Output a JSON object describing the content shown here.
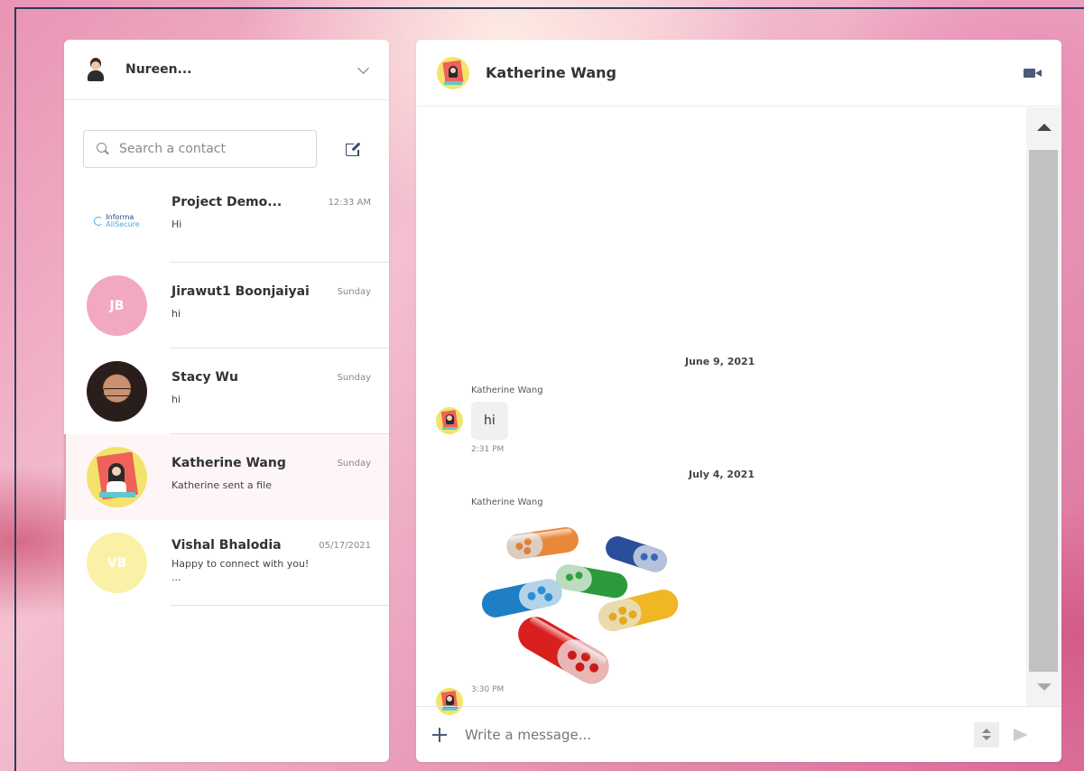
{
  "account": {
    "name": "Nureen..."
  },
  "search": {
    "placeholder": "Search a contact"
  },
  "contacts": [
    {
      "name": "Project Demo...",
      "preview": "Hi",
      "time": "12:33 AM",
      "avatar": "logo",
      "logo_line1": "Informa",
      "logo_line2": "AllSecure"
    },
    {
      "name": "Jirawut1 Boonjaiyai",
      "preview": "hi",
      "time": "Sunday",
      "avatar": "initials",
      "initials": "JB",
      "color": "#f2a8c0"
    },
    {
      "name": "Stacy Wu",
      "preview": "hi",
      "time": "Sunday",
      "avatar": "photo"
    },
    {
      "name": "Katherine Wang",
      "preview": "Katherine sent a file",
      "time": "Sunday",
      "avatar": "photo",
      "active": true
    },
    {
      "name": "Vishal Bhalodia",
      "preview": "Happy to connect with you!",
      "preview2": "...",
      "time": "05/17/2021",
      "avatar": "initials",
      "initials": "VB",
      "color": "#fbf1a6"
    }
  ],
  "chat": {
    "title": "Katherine Wang",
    "groups": [
      {
        "date": "June 9, 2021",
        "sender": "Katherine Wang",
        "text": "hi",
        "time": "2:31 PM"
      },
      {
        "date": "July 4, 2021",
        "sender": "Katherine Wang",
        "attachment": "image",
        "time": "3:30 PM"
      }
    ]
  },
  "composer": {
    "placeholder": "Write a message..."
  },
  "colors": {
    "accent": "#4a5a78",
    "active_row": "#fdf5f6",
    "bubble": "#f0f0f0"
  }
}
